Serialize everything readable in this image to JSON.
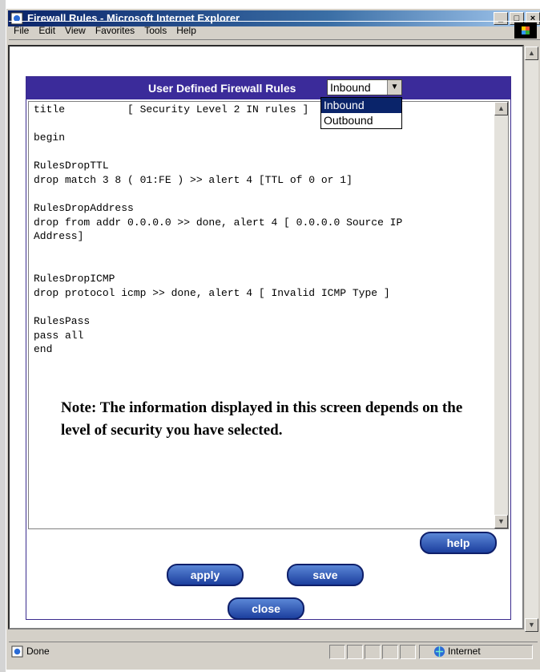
{
  "window": {
    "title": "Firewall Rules - Microsoft Internet Explorer"
  },
  "menu": [
    "File",
    "Edit",
    "View",
    "Favorites",
    "Tools",
    "Help"
  ],
  "panel": {
    "title": "User Defined Firewall Rules",
    "select_value": "Inbound"
  },
  "dropdown_options": [
    "Inbound",
    "Outbound"
  ],
  "rules_text": "title          [ Security Level 2 IN rules ]\n\nbegin\n\nRulesDropTTL\ndrop match 3 8 ( 01:FE ) >> alert 4 [TTL of 0 or 1]\n\nRulesDropAddress\ndrop from addr 0.0.0.0 >> done, alert 4 [ 0.0.0.0 Source IP\nAddress]\n\n\nRulesDropICMP\ndrop protocol icmp >> done, alert 4 [ Invalid ICMP Type ]\n\nRulesPass\npass all\nend",
  "note": "Note: The information displayed in this screen depends on the level of security you have selected.",
  "buttons": {
    "help": "help",
    "apply": "apply",
    "save": "save",
    "close": "close"
  },
  "status": {
    "text": "Done",
    "zone": "Internet"
  }
}
